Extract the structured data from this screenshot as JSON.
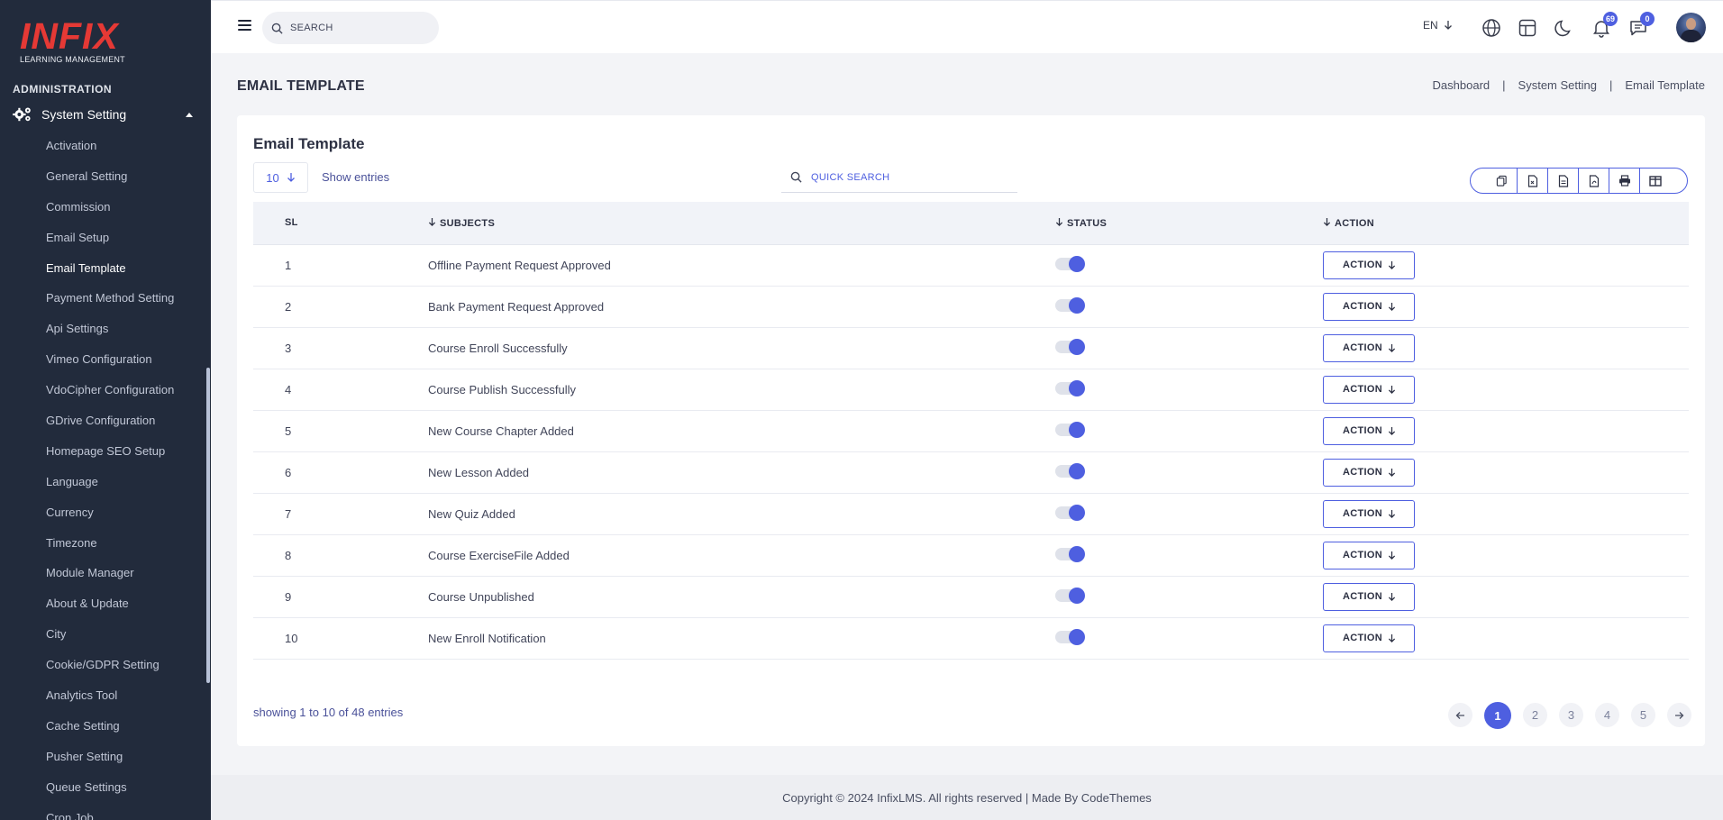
{
  "brand": {
    "logo_text": "INFIX",
    "logo_subtitle": "LEARNING MANAGEMENT"
  },
  "sidebar": {
    "section_label": "ADMINISTRATION",
    "group_label": "System Setting",
    "items": [
      {
        "label": "Activation"
      },
      {
        "label": "General Setting"
      },
      {
        "label": "Commission"
      },
      {
        "label": "Email Setup"
      },
      {
        "label": "Email Template",
        "active": true
      },
      {
        "label": "Payment Method Setting"
      },
      {
        "label": "Api Settings"
      },
      {
        "label": "Vimeo Configuration"
      },
      {
        "label": "VdoCipher Configuration"
      },
      {
        "label": "GDrive Configuration"
      },
      {
        "label": "Homepage SEO Setup"
      },
      {
        "label": "Language"
      },
      {
        "label": "Currency"
      },
      {
        "label": "Timezone"
      },
      {
        "label": "Module Manager"
      },
      {
        "label": "About & Update"
      },
      {
        "label": "City"
      },
      {
        "label": "Cookie/GDPR Setting"
      },
      {
        "label": "Analytics Tool"
      },
      {
        "label": "Cache Setting"
      },
      {
        "label": "Pusher Setting"
      },
      {
        "label": "Queue Settings"
      },
      {
        "label": "Cron Job"
      }
    ]
  },
  "topbar": {
    "search_placeholder": "SEARCH",
    "language": "EN",
    "notifications_count": "69",
    "messages_count": "0"
  },
  "page": {
    "title": "EMAIL TEMPLATE",
    "breadcrumb": [
      "Dashboard",
      "System Setting",
      "Email Template"
    ]
  },
  "card": {
    "title": "Email Template",
    "entries_value": "10",
    "show_entries_label": "Show entries",
    "quick_search_placeholder": "QUICK SEARCH",
    "export_icons": [
      "copy-icon",
      "csv-icon",
      "excel-icon",
      "pdf-icon",
      "print-icon",
      "columns-icon"
    ],
    "columns": [
      "SL",
      "SUBJECTS",
      "STATUS",
      "ACTION"
    ],
    "rows": [
      {
        "sl": "1",
        "subject": "Offline Payment Request Approved",
        "status_on": true,
        "action": "ACTION"
      },
      {
        "sl": "2",
        "subject": "Bank Payment Request Approved",
        "status_on": true,
        "action": "ACTION"
      },
      {
        "sl": "3",
        "subject": "Course Enroll Successfully",
        "status_on": true,
        "action": "ACTION"
      },
      {
        "sl": "4",
        "subject": "Course Publish Successfully",
        "status_on": true,
        "action": "ACTION"
      },
      {
        "sl": "5",
        "subject": "New Course Chapter Added",
        "status_on": true,
        "action": "ACTION"
      },
      {
        "sl": "6",
        "subject": "New Lesson Added",
        "status_on": true,
        "action": "ACTION"
      },
      {
        "sl": "7",
        "subject": "New Quiz Added",
        "status_on": true,
        "action": "ACTION"
      },
      {
        "sl": "8",
        "subject": "Course ExerciseFile Added",
        "status_on": true,
        "action": "ACTION"
      },
      {
        "sl": "9",
        "subject": "Course Unpublished",
        "status_on": true,
        "action": "ACTION"
      },
      {
        "sl": "10",
        "subject": "New Enroll Notification",
        "status_on": true,
        "action": "ACTION"
      }
    ],
    "showing_text": "showing 1 to 10 of 48 entries",
    "pages": [
      "1",
      "2",
      "3",
      "4",
      "5"
    ],
    "current_page": "1"
  },
  "footer": {
    "text": "Copyright © 2024 InfixLMS. All rights reserved | Made By CodeThemes"
  },
  "colors": {
    "accent": "#4e5fe0",
    "sidebar_bg": "#222b3c",
    "brand_red": "#e53935"
  }
}
